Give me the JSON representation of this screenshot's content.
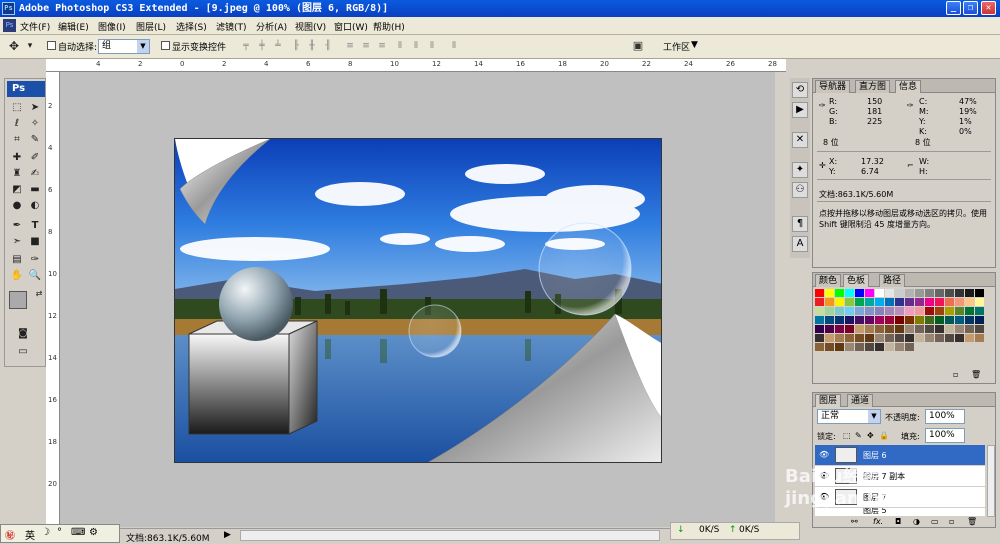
{
  "titlebar": {
    "title": "Adobe Photoshop CS3 Extended - [9.jpeg @ 100% (图层 6, RGB/8)]",
    "icon": "Ps"
  },
  "menu": {
    "items": [
      "文件(F)",
      "编辑(E)",
      "图像(I)",
      "图层(L)",
      "选择(S)",
      "滤镜(T)",
      "分析(A)",
      "视图(V)",
      "窗口(W)",
      "帮助(H)"
    ]
  },
  "options": {
    "auto_select_label": "自动选择:",
    "auto_select_value": "组",
    "show_transform_label": "显示变换控件",
    "workspace_label": "工作区"
  },
  "toolbox": {
    "logo": "Ps"
  },
  "ruler_top": [
    "4",
    "2",
    "0",
    "2",
    "4",
    "6",
    "8",
    "10",
    "12",
    "14",
    "16",
    "18",
    "20",
    "22",
    "24",
    "26",
    "28"
  ],
  "ruler_left": [
    "2",
    "4",
    "6",
    "8",
    "10",
    "12",
    "14",
    "16",
    "18",
    "20"
  ],
  "doc_status": "文档:863.1K/5.60M",
  "ime": {
    "text": "英"
  },
  "info_panel": {
    "tabs": [
      "导航器",
      "直方图",
      "信息"
    ],
    "r": "150",
    "g": "181",
    "b": "225",
    "c": "47%",
    "m": "19%",
    "y": "1%",
    "k": "0%",
    "bit_left": "8 位",
    "bit_right": "8 位",
    "x": "17.32",
    "yv": "6.74",
    "w": "",
    "h": "",
    "doc": "文档:863.1K/5.60M",
    "hint": "点按并拖移以移动图层或移动选区的拷贝。使用 Shift 键限制沿 45 度增量方向。"
  },
  "swatch_panel": {
    "tabs": [
      "颜色",
      "色板",
      "路径"
    ]
  },
  "layers_panel": {
    "tabs": [
      "图层",
      "通道"
    ],
    "blend_mode": "正常",
    "opacity_label": "不透明度:",
    "opacity": "100%",
    "lock_label": "锁定:",
    "fill_label": "填充:",
    "fill": "100%",
    "layers": [
      "图层 6",
      "图层 7 副本",
      "图层 7",
      "图层 5"
    ]
  },
  "status_right": {
    "down": "0K/S",
    "up": "0K/S"
  },
  "watermark": "Baidu经验 jingyan.baidu.com"
}
